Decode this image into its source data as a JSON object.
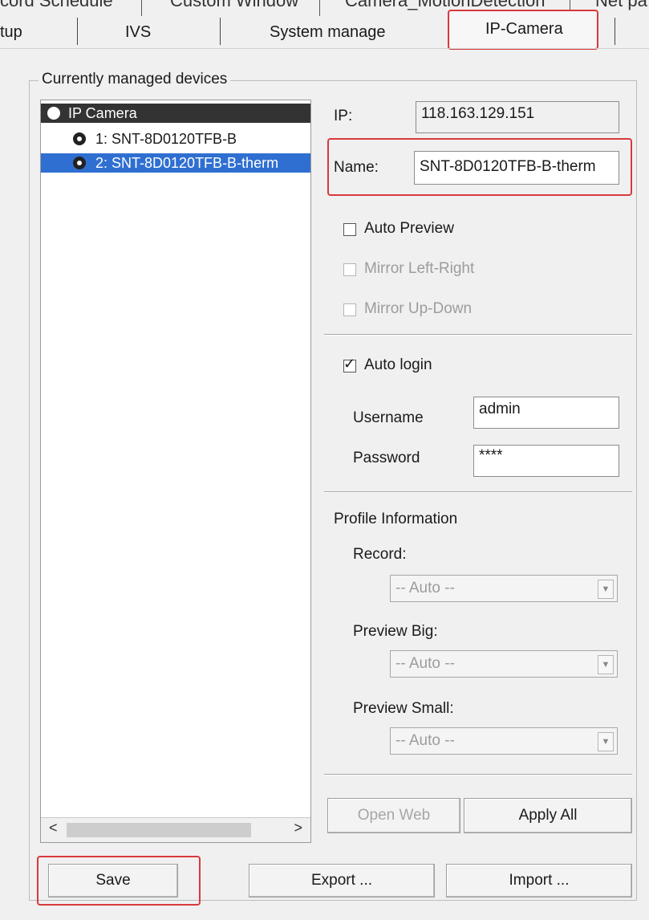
{
  "top_tabs": [
    "cord Schedule",
    "Custom Window",
    "Camera_MotionDetection",
    "Net pa"
  ],
  "tabs": [
    "tup",
    "IVS",
    "System manage",
    "IP-Camera"
  ],
  "group_title": "Currently managed devices",
  "device_list": {
    "root": "IP Camera",
    "items": [
      "1: SNT-8D0120TFB-B",
      "2: SNT-8D0120TFB-B-therm"
    ],
    "scroll_left": "<",
    "scroll_right": ">"
  },
  "ip": {
    "label": "IP:",
    "value": "118.163.129.151"
  },
  "name": {
    "label": "Name:",
    "value": "SNT-8D0120TFB-B-therm"
  },
  "auto_preview": {
    "label": "Auto Preview",
    "checked": false
  },
  "mirror_lr": {
    "label": "Mirror Left-Right",
    "checked": false
  },
  "mirror_ud": {
    "label": "Mirror Up-Down",
    "checked": false
  },
  "auto_login": {
    "label": "Auto login",
    "checked": true,
    "mark": "✓"
  },
  "username": {
    "label": "Username",
    "value": "admin"
  },
  "password": {
    "label": "Password",
    "value": "****"
  },
  "profile": {
    "title": "Profile Information",
    "record_label": "Record:",
    "record_value": "-- Auto --",
    "preview_big_label": "Preview Big:",
    "preview_big_value": "-- Auto --",
    "preview_small_label": "Preview Small:",
    "preview_small_value": "-- Auto --",
    "dropdown_glyph": "▼"
  },
  "buttons": {
    "open_web": "Open Web",
    "apply_all": "Apply All",
    "save": "Save",
    "export": "Export ...",
    "import": "Import ..."
  },
  "colors": {
    "highlight": "#d9393c",
    "selection": "#2f6fd1"
  }
}
